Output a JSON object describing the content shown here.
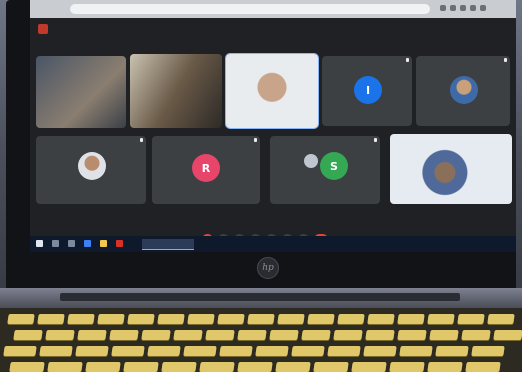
{
  "meeting": {
    "code": "",
    "time": ""
  },
  "participants": [
    {
      "name": "",
      "avatar": "",
      "color": "#5d6a80",
      "kind": "camera"
    },
    {
      "name": "",
      "avatar": "",
      "color": "#7a6a5a",
      "kind": "camera"
    },
    {
      "name": "",
      "avatar": "",
      "color": "#8a8f98",
      "kind": "camera"
    },
    {
      "name": "",
      "avatar": "I",
      "color": "#1a73e8",
      "kind": "avatar"
    },
    {
      "name": "",
      "avatar": "",
      "color": "#6b7b8f",
      "kind": "photo"
    },
    {
      "name": "",
      "avatar": "",
      "color": "#6b7b8f",
      "kind": "photo"
    },
    {
      "name": "",
      "avatar": "R",
      "color": "#e8456b",
      "kind": "avatar"
    },
    {
      "name": "",
      "avatar": "S",
      "color": "#34a853",
      "kind": "avatar"
    },
    {
      "name": "",
      "avatar": "",
      "color": "#7e8aa0",
      "kind": "camera"
    }
  ],
  "taskbar": {
    "active_app": "",
    "clock": ""
  },
  "brand": {
    "logo_text": "hp"
  }
}
